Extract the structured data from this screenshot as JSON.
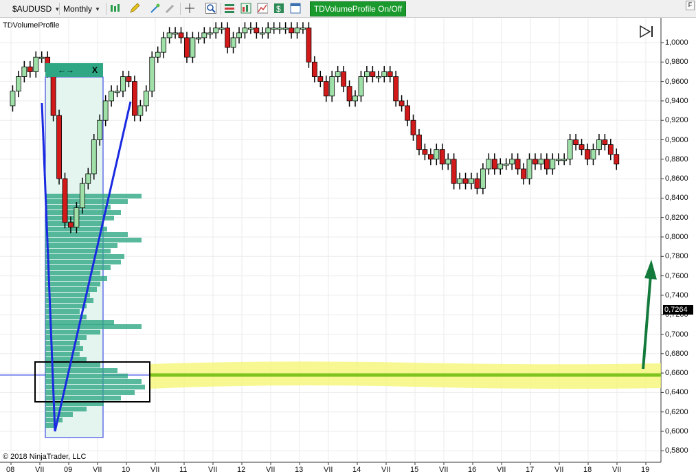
{
  "toolbar": {
    "instrument": "$AUDUSD",
    "period": "Monthly",
    "toggle_label": "TDVolumeProfile On/Off",
    "panel_button": "F"
  },
  "indicator_label": "TDVolumeProfile",
  "copyright": "© 2018 NinjaTrader, LLC",
  "profile_box": {
    "move_label": "←→",
    "close_label": "X"
  },
  "price_axis": {
    "labels": [
      "1,0000",
      "0,9800",
      "0,9600",
      "0,9400",
      "0,9200",
      "0,9000",
      "0,8800",
      "0,8600",
      "0,8400",
      "0,8200",
      "0,8000",
      "0,7800",
      "0,7600",
      "0,7400",
      "0,7200",
      "0,7000",
      "0,6800",
      "0,6600",
      "0,6400",
      "0,6200",
      "0,6000",
      "0,5800"
    ],
    "current_price": "0,7264"
  },
  "time_axis": {
    "labels": [
      "08",
      "VII",
      "09",
      "VII",
      "10",
      "VII",
      "11",
      "VII",
      "12",
      "VII",
      "13",
      "VII",
      "14",
      "VII",
      "15",
      "VII",
      "16",
      "VII",
      "17",
      "VII",
      "18",
      "VII",
      "19"
    ]
  },
  "colors": {
    "bull": "#9fe0a8",
    "bear": "#d21a1a",
    "profile": "#2fa784",
    "highlight": "#f5f56e",
    "poc_line": "#7fc41e",
    "trendline": "#1a2ae0",
    "arrow": "#137a3c",
    "toggle": "#1a9a2c"
  },
  "icons": [
    "bar-type-icon",
    "pencil-icon",
    "magic-wand-icon",
    "eraser-icon",
    "crosshair-icon",
    "zoom-icon",
    "strategy-icon",
    "chart-icon",
    "dollar-icon",
    "window-icon",
    "play-skip-icon"
  ]
}
